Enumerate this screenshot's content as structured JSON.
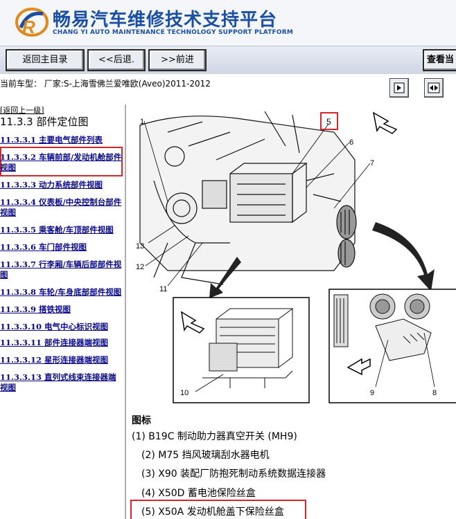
{
  "header": {
    "title": "畅易汽车维修技术支持平台",
    "subtitle": "CHANG YI AUTO MAINTENANCE TECHNOLOGY SUPPORT PLATFORM"
  },
  "toolbar": {
    "back_main": "返回主目录",
    "back": "<<后退.",
    "forward": ">>前进",
    "view": "查看当"
  },
  "car_info": "当前车型：  厂家:S-上海雪佛兰爱唯欧(Aveo)2011-2012",
  "nav": {
    "back_link": "[返回上一级]",
    "section_title": "11.3.3 部件定位图",
    "items": [
      {
        "label": "11.3.3.1 主要电气部件列表",
        "highlighted": false
      },
      {
        "label": "11.3.3.2 车辆前部/发动机舱部件视图",
        "highlighted": true
      },
      {
        "label": "11.3.3.3 动力系统部件视图",
        "highlighted": false
      },
      {
        "label": "11.3.3.4 仪表板/中央控制台部件视图",
        "highlighted": false
      },
      {
        "label": "11.3.3.5 乘客舱/车顶部件视图",
        "highlighted": false
      },
      {
        "label": "11.3.3.6 车门部件视图",
        "highlighted": false
      },
      {
        "label": "11.3.3.7 行李厢/车辆后部部件视图",
        "highlighted": false
      },
      {
        "label": "11.3.3.8 车轮/车身底部部件视图",
        "highlighted": false
      },
      {
        "label": "11.3.3.9 搭铁视图",
        "highlighted": false
      },
      {
        "label": "11.3.3.10 电气中心标识视图",
        "highlighted": false
      },
      {
        "label": "11.3.3.11 部件连接器端视图",
        "highlighted": false
      },
      {
        "label": "11.3.3.12 星形连接器端视图",
        "highlighted": false
      },
      {
        "label": "11.3.3.13 直列式线束连接器端视图",
        "highlighted": false
      }
    ]
  },
  "diagram": {
    "callouts": [
      "1",
      "5",
      "6",
      "7",
      "13",
      "12",
      "11",
      "10",
      "9",
      "8"
    ],
    "highlighted_callout": "5"
  },
  "legend": {
    "title": "图标",
    "items": [
      "(1) B19C 制动助力器真空开关 (MH9)",
      "(2) M75 挡风玻璃刮水器电机",
      "(3) X90 装配厂防抱死制动系统数据连接器",
      "(4) X50D 蓄电池保险丝盒",
      "(5) X50A 发动机舱盖下保险丝盒"
    ],
    "highlighted_index": 4
  },
  "colors": {
    "brand_blue": "#1a4fa3",
    "nav_link": "#0a0a8a",
    "highlight_red": "#d6262b",
    "divider_navy": "#1d2b5a"
  },
  "icons": [
    "logo-icon",
    "view-single-icon",
    "view-double-icon"
  ]
}
